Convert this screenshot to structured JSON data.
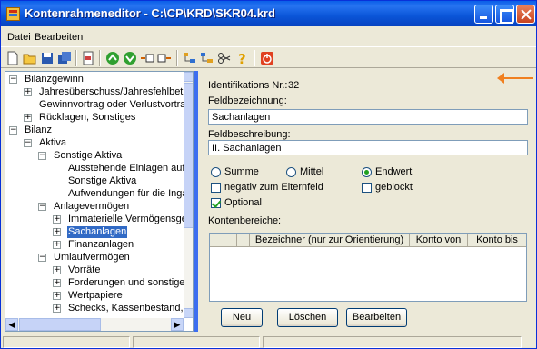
{
  "window": {
    "title": "Kontenrahmeneditor - C:\\CP\\KRD\\SKR04.krd"
  },
  "menu": [
    "Datei",
    "Bearbeiten"
  ],
  "toolbar_icons": [
    "new-icon",
    "open-icon",
    "save-icon",
    "save-all-icon",
    "page-icon",
    "up-icon",
    "down-icon",
    "insert-before-icon",
    "insert-after-icon",
    "tree-expand-icon",
    "tree-collapse-icon",
    "scissors-icon",
    "help-icon",
    "exit-icon"
  ],
  "tree": [
    {
      "label": "Bilanzgewinn",
      "exp": "-"
    },
    {
      "label": "Jahresüberschuss/Jahresfehlbetrag",
      "exp": "+"
    },
    {
      "label": "Gewinnvortrag oder Verlustvortrag",
      "exp": ""
    },
    {
      "label": "Rücklagen, Sonstiges",
      "exp": "+"
    },
    {
      "label": "Bilanz",
      "exp": "-"
    },
    {
      "label": "Aktiva",
      "exp": "-"
    },
    {
      "label": "Sonstige Aktiva",
      "exp": "-"
    },
    {
      "label": "Ausstehende Einlagen auf das",
      "exp": ""
    },
    {
      "label": "Sonstige Aktiva",
      "exp": ""
    },
    {
      "label": "Aufwendungen für die Ingangs",
      "exp": ""
    },
    {
      "label": "Anlagevermögen",
      "exp": "-"
    },
    {
      "label": "Immaterielle Vermögensgegens",
      "exp": "+"
    },
    {
      "label": "Sachanlagen",
      "exp": "+",
      "selected": true
    },
    {
      "label": "Finanzanlagen",
      "exp": "+"
    },
    {
      "label": "Umlaufvermögen",
      "exp": "-"
    },
    {
      "label": "Vorräte",
      "exp": "+"
    },
    {
      "label": "Forderungen und sonstige Verm",
      "exp": "+"
    },
    {
      "label": "Wertpapiere",
      "exp": "+"
    },
    {
      "label": "Schecks, Kassenbestand, Bund",
      "exp": "+"
    }
  ],
  "detail": {
    "id_label": "Identifikations Nr.:",
    "id_value": "32",
    "feldbezeichnung_label": "Feldbezeichnung:",
    "feldbezeichnung_value": "Sachanlagen",
    "feldbeschreibung_label": "Feldbeschreibung:",
    "feldbeschreibung_value": "II.  Sachanlagen",
    "radios": [
      {
        "label": "Summe",
        "checked": false
      },
      {
        "label": "Mittel",
        "checked": false
      },
      {
        "label": "Endwert",
        "checked": true
      }
    ],
    "checkboxes": [
      {
        "label": "negativ zum Elternfeld",
        "checked": false
      },
      {
        "label": "geblockt",
        "checked": false
      },
      {
        "label": "Optional",
        "checked": true
      }
    ],
    "kontenbereiche_label": "Kontenbereiche:",
    "columns": [
      "",
      "",
      "",
      "Bezeichner (nur zur Orientierung)",
      "Konto von",
      "Konto bis"
    ],
    "buttons": {
      "neu": "Neu",
      "loeschen": "Löschen",
      "bearbeiten": "Bearbeiten"
    }
  },
  "colors": {
    "accent": "#0a5fe8",
    "splitter": "#3c6ef0",
    "selection": "#316ac5",
    "arrow": "#f08020"
  }
}
